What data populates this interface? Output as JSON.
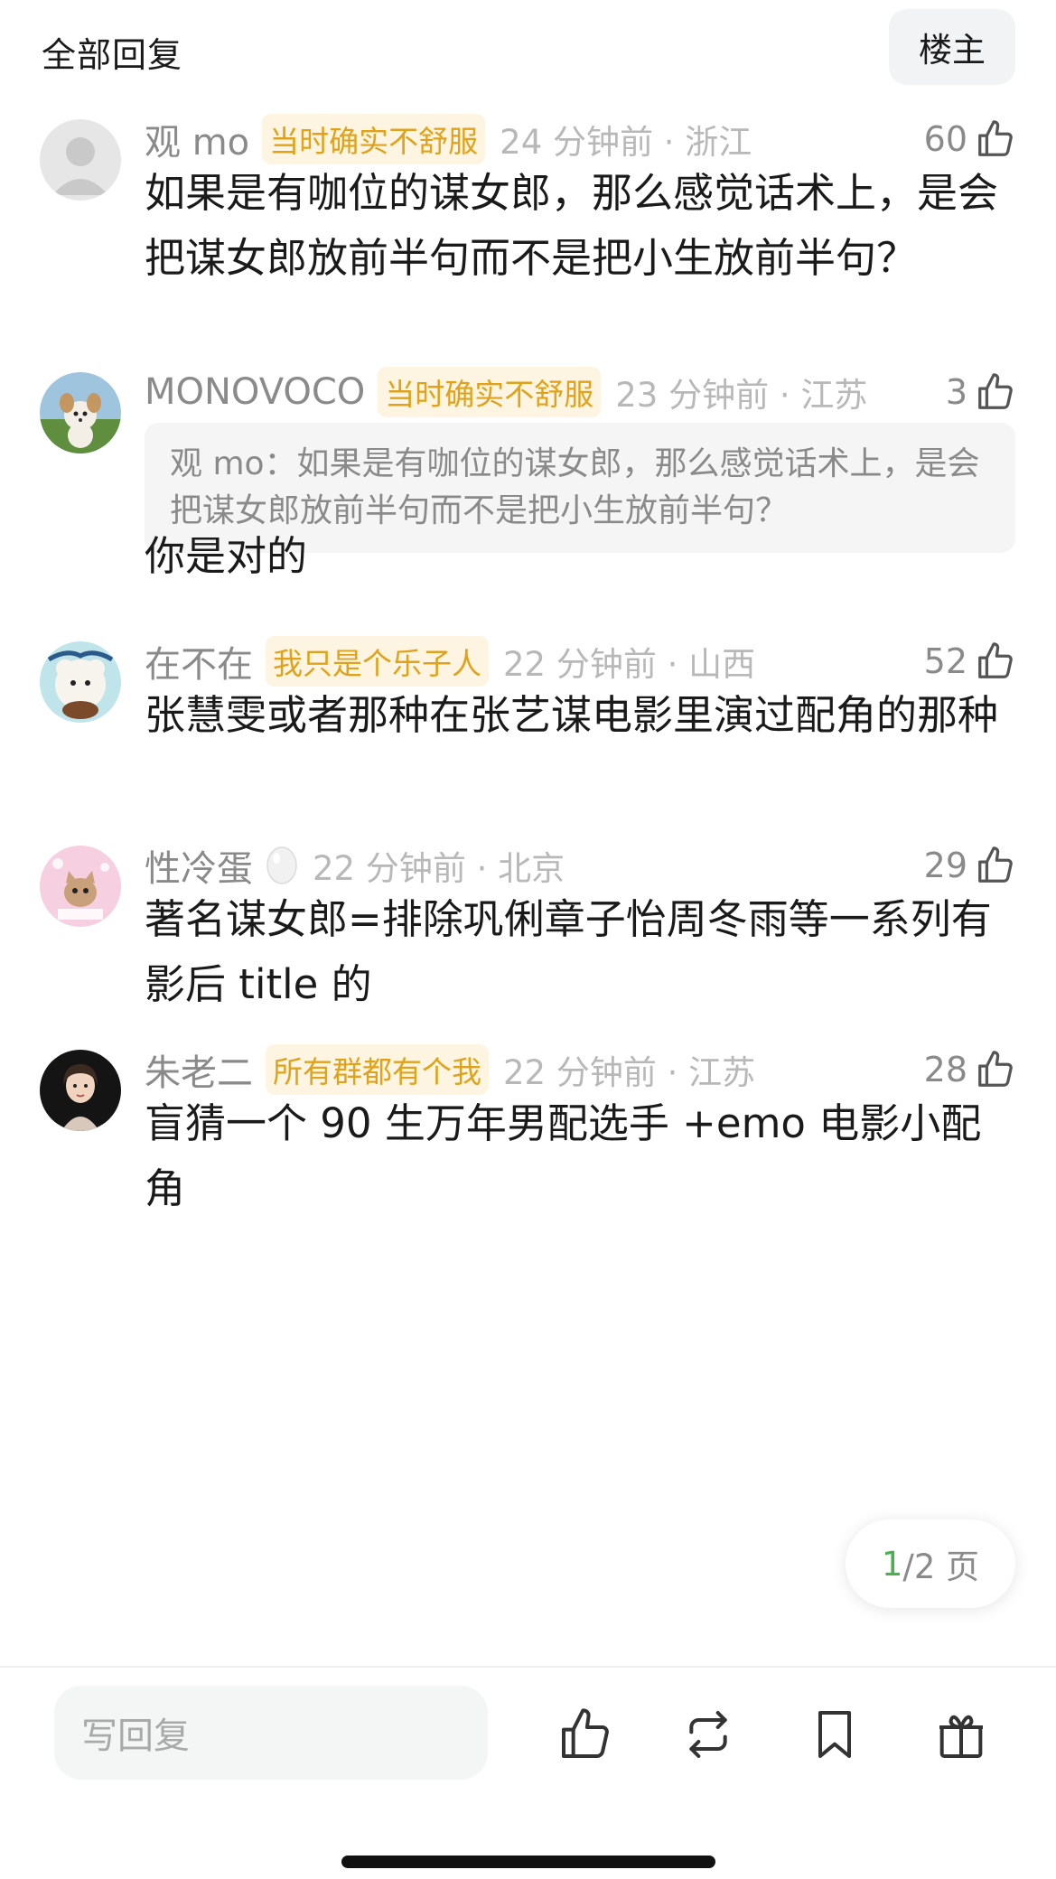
{
  "header": {
    "title": "全部回复",
    "op_button": "楼主"
  },
  "comments": [
    {
      "username": "观 mo",
      "badge": "当时确实不舒服",
      "meta": "24 分钟前 · 浙江",
      "likes": "60",
      "avatar": "default-avatar",
      "text": "如果是有咖位的谋女郎，那么感觉话术上，是会把谋女郎放前半句而不是把小生放前半句？"
    },
    {
      "username": "MONOVOCO",
      "badge": "当时确实不舒服",
      "meta": "23 分钟前 · 江苏",
      "likes": "3",
      "avatar": "dog-avatar",
      "quote": "观 mo：如果是有咖位的谋女郎，那么感觉话术上，是会把谋女郎放前半句而不是把小生放前半句？",
      "text": "你是对的"
    },
    {
      "username": "在不在",
      "badge": "我只是个乐子人",
      "meta": "22 分钟前 · 山西",
      "likes": "52",
      "avatar": "cartoon-avatar",
      "text": "张慧雯或者那种在张艺谋电影里演过配角的那种"
    },
    {
      "username": "性冷蛋",
      "badge": "",
      "meta": "22 分钟前 · 北京",
      "likes": "29",
      "avatar": "cat-avatar",
      "emoji": "egg-icon",
      "text": "著名谋女郎=排除巩俐章子怡周冬雨等一系列有影后 title 的"
    },
    {
      "username": "朱老二",
      "badge": "所有群都有个我",
      "meta": "22 分钟前 · 江苏",
      "likes": "28",
      "avatar": "woman-avatar",
      "text": "盲猜一个 90 生万年男配选手 +emo 电影小配角"
    }
  ],
  "pager": {
    "current": "1",
    "rest": "/2 页"
  },
  "bottom_bar": {
    "reply_placeholder": "写回复",
    "icons": [
      "thumbs-up-icon",
      "repost-icon",
      "bookmark-icon",
      "gift-icon"
    ]
  },
  "colors": {
    "badge_text": "#e0a21a",
    "badge_bg": "#fdf5e2",
    "pager_current": "#4caf50",
    "muted": "#8a8a8a"
  }
}
